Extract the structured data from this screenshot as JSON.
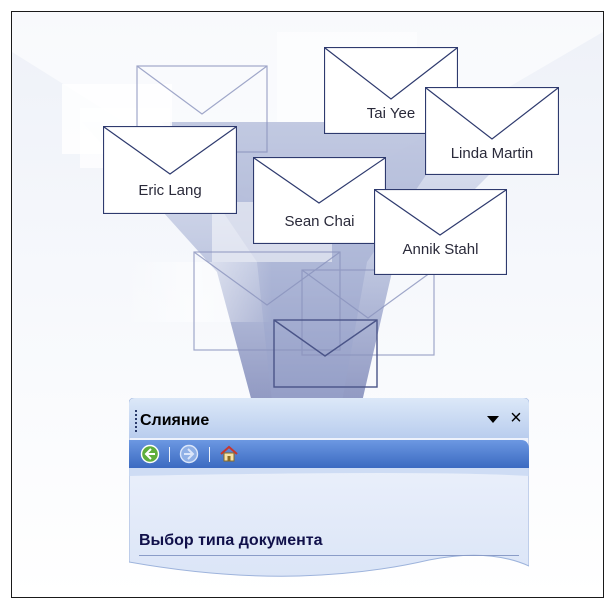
{
  "envelopes": [
    {
      "label": "Tai Yee"
    },
    {
      "label": "Linda Martin"
    },
    {
      "label": "Eric Lang"
    },
    {
      "label": "Sean Chai"
    },
    {
      "label": "Annik Stahl"
    }
  ],
  "task_pane": {
    "title": "Слияние",
    "section_heading": "Выбор типа документа"
  },
  "icons": {
    "back": "back-arrow-icon",
    "forward": "forward-arrow-icon",
    "home": "home-icon",
    "dropdown": "triangle-down-icon",
    "close": "close-icon"
  },
  "colors": {
    "funnel": "#8f99c2",
    "envelope_stroke": "#2e3a6e",
    "pane_header": "#c9daf3",
    "nav_bar": "#4f7fd0"
  }
}
